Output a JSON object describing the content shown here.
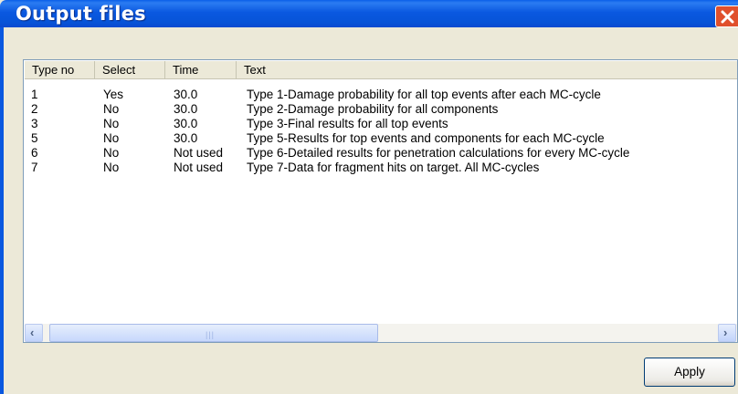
{
  "window": {
    "title": "Output files"
  },
  "columns": [
    "Type no",
    "Select",
    "Time",
    "Text"
  ],
  "rows": [
    {
      "type_no": "1",
      "select": "Yes",
      "time": "30.0",
      "text": "Type 1-Damage probability for all top events after each MC-cycle"
    },
    {
      "type_no": "2",
      "select": "No",
      "time": "30.0",
      "text": "Type 2-Damage probability for all components"
    },
    {
      "type_no": "3",
      "select": "No",
      "time": "30.0",
      "text": "Type 3-Final results for all top events"
    },
    {
      "type_no": "5",
      "select": "No",
      "time": "30.0",
      "text": "Type 5-Results for top events and components for each MC-cycle"
    },
    {
      "type_no": "6",
      "select": "No",
      "time": "Not used",
      "text": "Type 6-Detailed results for penetration calculations for every MC-cycle"
    },
    {
      "type_no": "7",
      "select": "No",
      "time": "Not used",
      "text": "Type 7-Data for fragment hits on target. All MC-cycles"
    }
  ],
  "buttons": {
    "apply": "Apply"
  },
  "icons": {
    "close": "close-icon",
    "scroll_left": "arrow-left-icon",
    "scroll_right": "arrow-right-icon"
  },
  "colors": {
    "titlebar": "#0a58e0",
    "close": "#e0502c",
    "dialog": "#ece9d8"
  }
}
